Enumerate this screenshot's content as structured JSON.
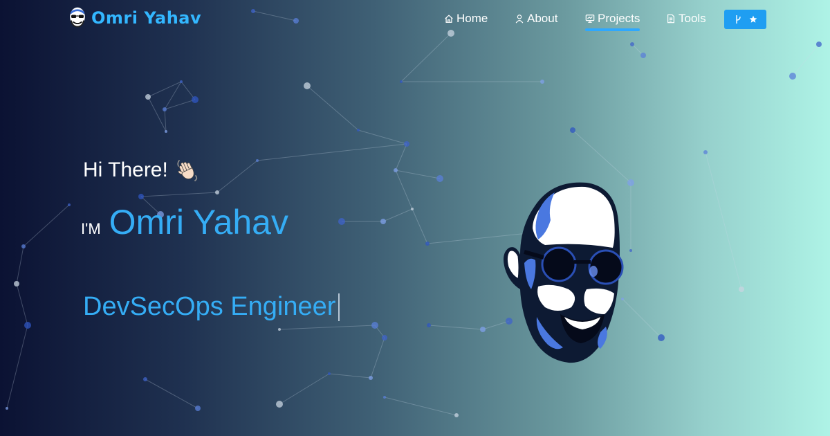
{
  "brand": {
    "name": "Omri Yahav",
    "logo_icon": "avatar-icon"
  },
  "nav": {
    "items": [
      {
        "label": "Home",
        "icon": "home-icon",
        "active": false
      },
      {
        "label": "About",
        "icon": "user-icon",
        "active": false
      },
      {
        "label": "Projects",
        "icon": "projects-icon",
        "active": true
      },
      {
        "label": "Tools",
        "icon": "document-icon",
        "active": false
      }
    ],
    "repo_button": {
      "icons": [
        "git-fork-icon",
        "star-icon"
      ]
    }
  },
  "hero": {
    "greeting": "Hi There!",
    "greeting_icon": "waving-hand-icon",
    "intro_prefix": "I'M",
    "name": "Omri Yahav",
    "role": "DevSecOps Engineer",
    "portrait_icon": "portrait-illustration"
  },
  "colors": {
    "accent": "#35adf5",
    "button": "#1f9ef2",
    "gradient_start": "#0b1233",
    "gradient_end": "#aef3e6"
  }
}
